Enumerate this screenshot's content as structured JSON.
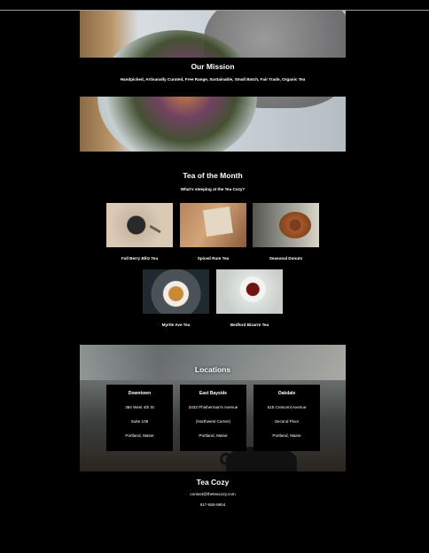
{
  "mission": {
    "title": "Our Mission",
    "text": "Handpicked, Artisanally Curated, Free Range, Sustainable, Small Batch, Fair Trade, Organic Tea"
  },
  "tea_of_month": {
    "title": "Tea of the Month",
    "subtitle": "What's steeping at the Tea Cozy?",
    "items": [
      {
        "name": "Fall Berry Blitz Tea",
        "image": "fall-berry-image"
      },
      {
        "name": "Spiced Rum Tea",
        "image": "spiced-rum-image"
      },
      {
        "name": "Seasonal Donuts",
        "image": "donuts-image"
      },
      {
        "name": "Myrtle Ave Tea",
        "image": "myrtle-ave-image"
      },
      {
        "name": "Bedford Bizarre Tea",
        "image": "bedford-bizarre-image"
      }
    ]
  },
  "locations": {
    "title": "Locations",
    "items": [
      {
        "name": "Downtown",
        "line1": "384 West 4th St",
        "line2": "Suite 108",
        "line3": "Portland, Maine"
      },
      {
        "name": "East Bayside",
        "line1": "3433 Phisherman's Avenue",
        "line2": "(Northwest Corner)",
        "line3": "Portland, Maine"
      },
      {
        "name": "Oakdale",
        "line1": "515 Crescent Avenue",
        "line2": "Second Floor",
        "line3": "Portland, Maine"
      }
    ]
  },
  "footer": {
    "title": "Tea Cozy",
    "email": "contact@theteacozy.com",
    "phone": "917-555-8904"
  }
}
